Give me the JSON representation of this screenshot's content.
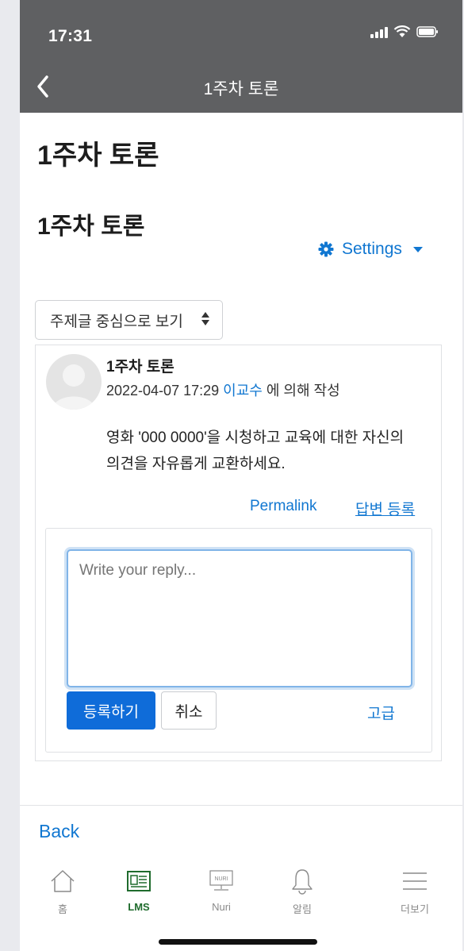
{
  "status_bar": {
    "time": "17:31"
  },
  "header": {
    "title": "1주차 토론"
  },
  "page": {
    "title": "1주차 토론",
    "subtitle": "1주차 토론",
    "settings_label": "Settings",
    "view_mode": "주제글 중심으로 보기"
  },
  "post": {
    "title": "1주차 토론",
    "date": "2022-04-07 17:29",
    "author": "이교수",
    "author_suffix": "에 의해 작성",
    "body_line1": "영화 '000 0000'을 시청하고 교육에 대한 자신의",
    "body_line2": "의견을 자유롭게 교환하세요.",
    "permalink_label": "Permalink",
    "reply_label": "답변 등록"
  },
  "reply": {
    "placeholder": "Write your reply...",
    "submit_label": "등록하기",
    "cancel_label": "취소",
    "advanced_label": "고급"
  },
  "footer": {
    "back_label": "Back"
  },
  "tabbar": {
    "items": [
      {
        "label": "홈",
        "icon": "home-icon"
      },
      {
        "label": "LMS",
        "icon": "lms-icon"
      },
      {
        "label": "Nuri",
        "icon": "nuri-icon",
        "icon_text": "NURI"
      },
      {
        "label": "알림",
        "icon": "bell-icon"
      },
      {
        "label": "더보기",
        "icon": "menu-icon"
      }
    ],
    "active": "LMS"
  },
  "colors": {
    "header_bg": "#5f6062",
    "link": "#1177d1",
    "primary_button": "#0f6cd9",
    "active_tab": "#1f6b2d"
  }
}
